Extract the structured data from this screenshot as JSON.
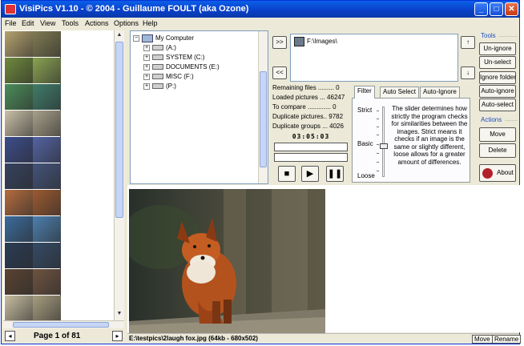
{
  "window": {
    "title": "VisiPics V1.10 - © 2004 - Guillaume FOULT (aka Ozone)"
  },
  "menu": [
    "File",
    "Edit",
    "View",
    "Tools",
    "Actions",
    "Options",
    "Help"
  ],
  "thumbnails": {
    "colors": [
      [
        "#b5a26e",
        "#7f7a52"
      ],
      [
        "#6f8a3c",
        "#8aa252"
      ],
      [
        "#4b8d5a",
        "#3f7c6a"
      ],
      [
        "#c9c0a8",
        "#a8a08a"
      ],
      [
        "#3c4d8c",
        "#5363a3"
      ],
      [
        "#35425f",
        "#43537a"
      ],
      [
        "#b46c3e",
        "#9c5a30"
      ],
      [
        "#3b6b9c",
        "#4c7fae"
      ],
      [
        "#2a3c55",
        "#354a66"
      ],
      [
        "#5a4332",
        "#6e5340"
      ],
      [
        "#c7bda0",
        "#a89d80"
      ]
    ],
    "page_label": "Page 1 of 81"
  },
  "tree": {
    "items": [
      {
        "label": "My Computer",
        "kind": "computer"
      },
      {
        "label": "(A:)",
        "kind": "drive"
      },
      {
        "label": "SYSTEM (C:)",
        "kind": "drive"
      },
      {
        "label": "DOCUMENTS (E:)",
        "kind": "drive"
      },
      {
        "label": "MISC (F:)",
        "kind": "drive"
      },
      {
        "label": "(P:)",
        "kind": "drive"
      }
    ]
  },
  "folders": {
    "add_label": ">>",
    "remove_label": "<<",
    "entries": [
      "F:\\Images\\"
    ],
    "up_label": "↑",
    "down_label": "↓"
  },
  "stats": {
    "remaining": "Remaining files ......... 0",
    "loaded": "Loaded pictures ... 46247",
    "to_compare": "To compare ............. 0",
    "dup_pictures": "Duplicate pictures.. 9782",
    "dup_groups": "Duplicate groups ... 4026",
    "timer": "03:05:03"
  },
  "controls": {
    "stop": "■",
    "play": "▶",
    "pause": "❚❚"
  },
  "tabs": [
    "Filter",
    "Auto Select",
    "Auto-Ignore"
  ],
  "filter": {
    "strict": "Strict",
    "basic": "Basic",
    "loose": "Loose",
    "level_fraction": 0.55,
    "description": "The slider determines how strictly the program checks for similarities between the images. Strict means it checks if an image is the same or slightly different, loose allows for a greater amount of differences."
  },
  "tools": {
    "label": "Tools",
    "buttons": [
      "Un-ignore",
      "Un-select",
      "Ignore folder",
      "Auto-ignore",
      "Auto-select"
    ]
  },
  "actions": {
    "label": "Actions",
    "buttons": [
      "Move",
      "Delete"
    ],
    "about": "About"
  },
  "status": {
    "file_info": "E:\\testpics\\2laugh fox.jpg (64kb - 680x502)",
    "move_label": "Move",
    "rename_label": "Rename"
  },
  "colors": {
    "title_bar": "#0a4fd8",
    "accent": "#1f4fbf",
    "window_bg": "#ece9d8"
  }
}
